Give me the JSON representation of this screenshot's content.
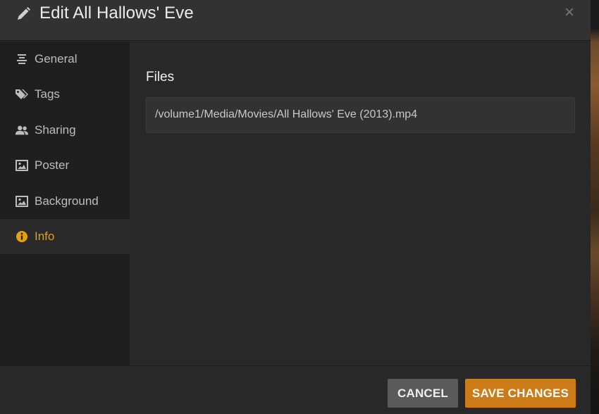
{
  "header": {
    "title": "Edit All Hallows' Eve",
    "close_glyph": "×"
  },
  "sidebar": {
    "items": [
      {
        "id": "general",
        "label": "General",
        "icon": "align-center-icon",
        "active": false
      },
      {
        "id": "tags",
        "label": "Tags",
        "icon": "tags-icon",
        "active": false
      },
      {
        "id": "sharing",
        "label": "Sharing",
        "icon": "users-icon",
        "active": false
      },
      {
        "id": "poster",
        "label": "Poster",
        "icon": "picture-icon",
        "active": false
      },
      {
        "id": "background",
        "label": "Background",
        "icon": "picture-icon",
        "active": false
      },
      {
        "id": "info",
        "label": "Info",
        "icon": "info-icon",
        "active": true
      }
    ]
  },
  "main": {
    "section_title": "Files",
    "files": [
      "/volume1/Media/Movies/All Hallows' Eve (2013).mp4"
    ]
  },
  "footer": {
    "cancel_label": "CANCEL",
    "save_label": "SAVE CHANGES"
  },
  "colors": {
    "accent": "#e5a00d",
    "save_button": "#cc7b19",
    "cancel_button": "#5a5a5a"
  }
}
